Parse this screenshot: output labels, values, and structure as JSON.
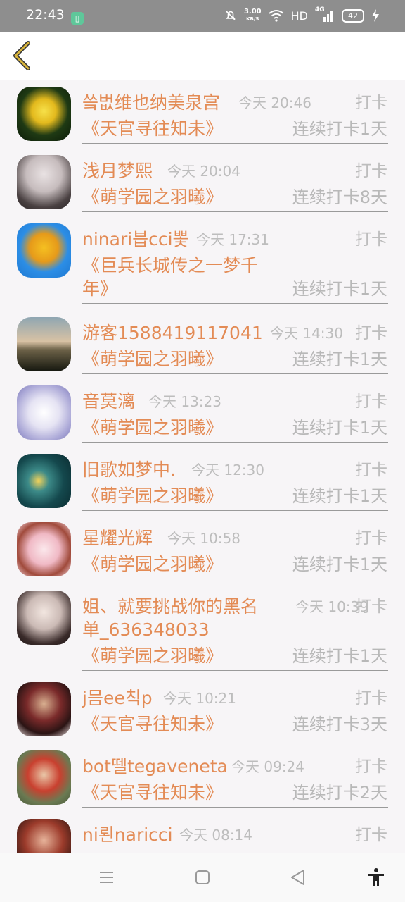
{
  "status": {
    "time": "22:43",
    "speed_value": "3.00",
    "speed_unit": "KB/S",
    "network": "HD",
    "signal": "4G",
    "battery": "42"
  },
  "icons": {
    "back": "chevron-left-icon",
    "menu": "menu-icon",
    "home": "home-icon",
    "nav_back": "triangle-back-icon",
    "accessibility": "accessibility-icon"
  },
  "colors": {
    "accent": "#e38b55",
    "muted": "#bdbdbd",
    "back_arrow": "#d8b43b"
  },
  "entries": [
    {
      "name": "씈벖维也纳美泉宫",
      "time": "今天 20:46",
      "tag": "打卡",
      "book": "《天官寻往知未》",
      "streak": "连续打卡1天"
    },
    {
      "name": "浅月梦熙",
      "time": "今天 20:04",
      "tag": "打卡",
      "book": "《萌学园之羽曦》",
      "streak": "连续打卡8天"
    },
    {
      "name": "ninari븝cci뽗",
      "time": "今天 17:31",
      "tag": "打卡",
      "book": "《巨兵长城传之一梦千",
      "book2": "年》",
      "streak": "连续打卡1天"
    },
    {
      "name": "游客1588419117041",
      "time": "今天 14:30",
      "tag": "打卡",
      "book": "《萌学园之羽曦》",
      "streak": "连续打卡1天"
    },
    {
      "name": "音莫漓",
      "time": "今天 13:23",
      "tag": "打卡",
      "book": "《萌学园之羽曦》",
      "streak": "连续打卡1天"
    },
    {
      "name": "旧歌如梦中.",
      "time": "今天 12:30",
      "tag": "打卡",
      "book": "《萌学园之羽曦》",
      "streak": "连续打卡1天"
    },
    {
      "name": "星耀光辉",
      "time": "今天 10:58",
      "tag": "打卡",
      "book": "《萌学园之羽曦》",
      "streak": "连续打卡1天"
    },
    {
      "name": "姐、就要挑战你的黑名",
      "name2": "单_636348033",
      "time": "今天 10:39",
      "tag": "打卡",
      "book": "《萌学园之羽曦》",
      "streak": "连续打卡1天"
    },
    {
      "name": "j믐ee칙p",
      "time": "今天 10:21",
      "tag": "打卡",
      "book": "《天官寻往知未》",
      "streak": "连续打卡3天"
    },
    {
      "name": "bot뗄tegaveneta",
      "time": "今天 09:24",
      "tag": "打卡",
      "book": "《天官寻往知未》",
      "streak": "连续打卡2天"
    },
    {
      "name": "ni뢴naricci",
      "time": "今天 08:14",
      "tag": "打卡"
    }
  ]
}
